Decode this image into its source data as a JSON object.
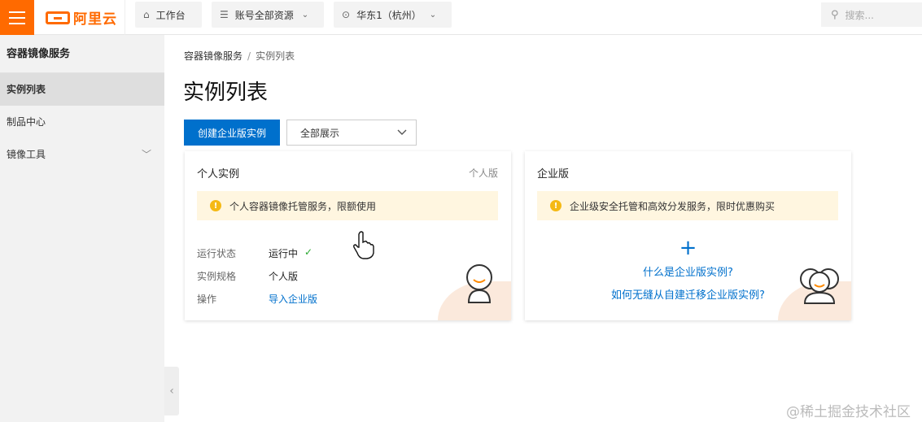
{
  "topbar": {
    "logo_text": "阿里云",
    "workbench_label": "工作台",
    "resources_label": "账号全部资源",
    "region_label": "华东1（杭州）",
    "search_placeholder": "搜索..."
  },
  "sidebar": {
    "title": "容器镜像服务",
    "items": [
      {
        "label": "实例列表",
        "active": true
      },
      {
        "label": "制品中心"
      },
      {
        "label": "镜像工具",
        "expandable": true
      }
    ]
  },
  "breadcrumb": {
    "root": "容器镜像服务",
    "separator": "/",
    "current": "实例列表"
  },
  "page": {
    "title": "实例列表",
    "create_button": "创建企业版实例",
    "filter_select": "全部展示"
  },
  "personal_card": {
    "title": "个人实例",
    "tag": "个人版",
    "notice": "个人容器镜像托管服务，限额使用",
    "rows": [
      {
        "key": "运行状态",
        "value": "运行中"
      },
      {
        "key": "实例规格",
        "value": "个人版"
      },
      {
        "key": "操作",
        "value": "导入企业版"
      }
    ]
  },
  "enterprise_card": {
    "title": "企业版",
    "notice": "企业级安全托管和高效分发服务，限时优惠购买",
    "link1": "什么是企业版实例?",
    "link2": "如何无缝从自建迁移企业版实例?"
  },
  "watermark": "@稀土掘金技术社区",
  "colors": {
    "brand": "#ff6a00",
    "primary": "#0070cc",
    "notice_bg": "#fff6e0",
    "warn": "#f5b914",
    "success": "#2aa830"
  }
}
